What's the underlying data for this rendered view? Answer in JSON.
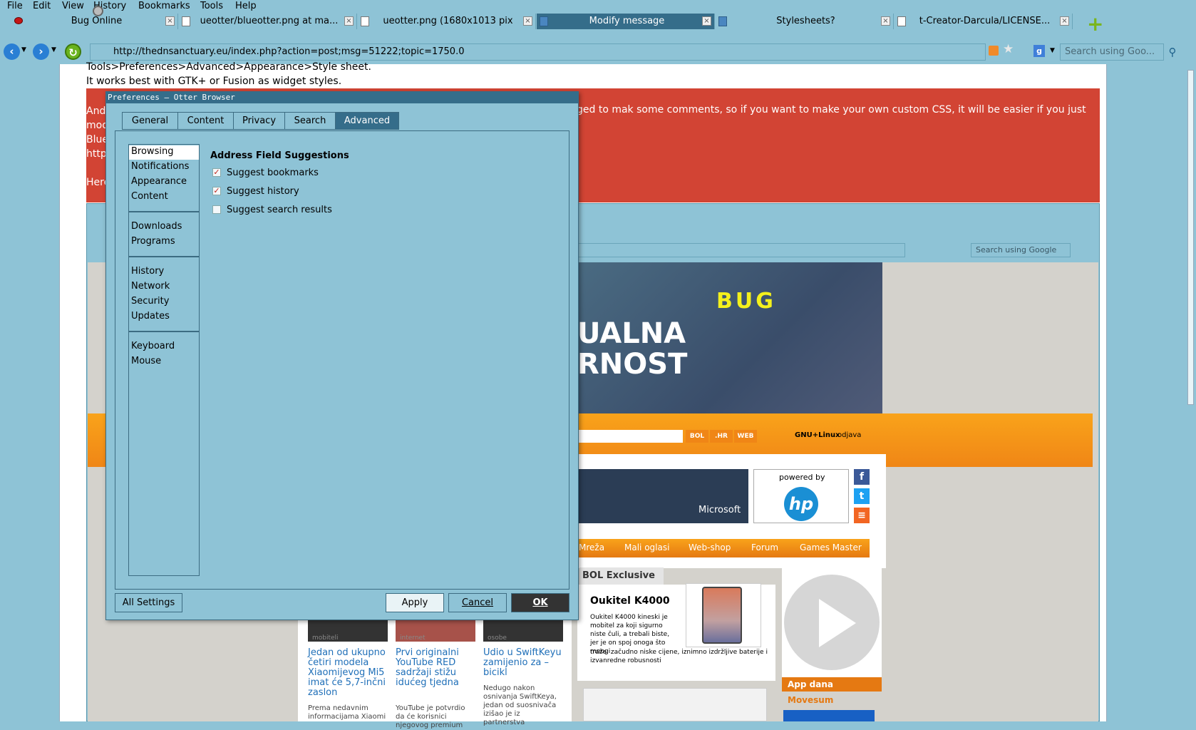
{
  "menubar": [
    "File",
    "Edit",
    "View",
    "History",
    "Bookmarks",
    "Tools",
    "Help"
  ],
  "tabs": [
    {
      "title": "Bug Online"
    },
    {
      "title": "ueotter/blueotter.png at ma..."
    },
    {
      "title": "ueotter.png (1680x1013 pix"
    },
    {
      "title": "Modify message"
    },
    {
      "title": "Stylesheets?"
    },
    {
      "title": "t-Creator-Darcula/LICENSE..."
    }
  ],
  "new_tab": "+",
  "address": {
    "url": "http://thednsanctuary.eu/index.php?action=post;msg=51222;topic=1750.0",
    "search_placeholder": "Search using Goo..."
  },
  "page": {
    "line1": "Tools>Preferences>Advanced>Appearance>Style sheet.",
    "line2": "It works best with GTK+ or Fusion as widget styles.",
    "red_line": "ged to mak some comments, so if you want to make your own custom CSS, it will be easier if you just",
    "red_left": [
      "And",
      "mod",
      "Blue",
      "http",
      "",
      "Here"
    ]
  },
  "embedded": {
    "search_placeholder": "Search using Google",
    "banner_line1": "UALNA",
    "banner_line2": "RNOST",
    "banner_brand": "BUG",
    "bol_buttons": [
      "BOL",
      ".HR",
      "WEB"
    ],
    "gnulinux": "GNU+Linux",
    "odjava": "odjava",
    "microsoft": "Microsoft",
    "powered_by": "powered by",
    "hp": "hp",
    "menu": [
      "Mreža",
      "Mali oglasi",
      "Web-shop",
      "Forum",
      "Games Master"
    ],
    "bol_exclusive": "BOL Exclusive",
    "oukitel_title": "Oukitel K4000",
    "oukitel_text": "Oukitel K4000 kineski je mobitel za koji sigurno niste čuli, a trebali biste, jer je on spoj onoga što mnogi",
    "oukitel_text2": "traže: začudno niske cijene, iznimno izdržljive baterije i izvanredne robusnosti",
    "app_dana": "App dana",
    "movesum": "Movesum",
    "news": [
      {
        "cat": "mobiteli",
        "head": "Jedan od ukupno četiri modela Xiaomijevog Mi5 imat će 5,7-inčni zaslon",
        "snip": "Prema nedavnim informacijama Xiaomi"
      },
      {
        "cat": "internet",
        "head": "Prvi originalni YouTube RED sadržaji stižu idućeg tjedna",
        "snip": "YouTube je potvrdio da će korisnici njegovog premium"
      },
      {
        "cat": "osobe",
        "head": "Udio u SwiftKeyu zamijenio za – bicikl",
        "snip": "Nedugo nakon osnivanja SwiftKeya, jedan od suosnivača izišao je iz partnerstva"
      }
    ]
  },
  "dialog": {
    "title": "Preferences – Otter Browser",
    "tabs": [
      "General",
      "Content",
      "Privacy",
      "Search",
      "Advanced"
    ],
    "active_tab": "Advanced",
    "categories": {
      "group1": [
        "Browsing",
        "Notifications",
        "Appearance",
        "Content"
      ],
      "group2": [
        "Downloads",
        "Programs"
      ],
      "group3": [
        "History",
        "Network",
        "Security",
        "Updates"
      ],
      "group4": [
        "Keyboard",
        "Mouse"
      ]
    },
    "selected_category": "Browsing",
    "section_title": "Address Field Suggestions",
    "options": [
      {
        "label": "Suggest bookmarks",
        "checked": true
      },
      {
        "label": "Suggest history",
        "checked": true
      },
      {
        "label": "Suggest search results",
        "checked": false
      }
    ],
    "buttons": {
      "all_settings": "All Settings",
      "apply": "Apply",
      "cancel": "Cancel",
      "ok": "OK"
    }
  }
}
